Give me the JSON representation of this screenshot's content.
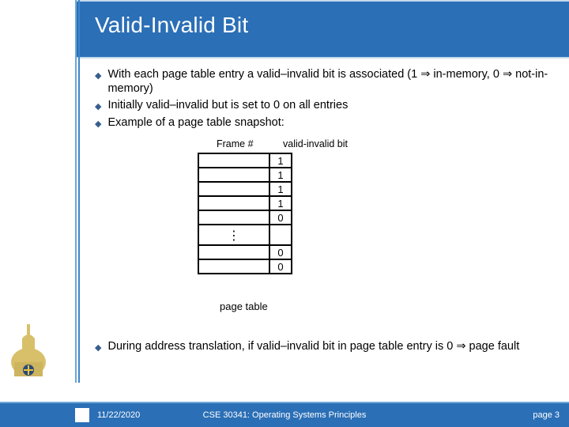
{
  "title": "Valid-Invalid Bit",
  "bullets_top": [
    "With each page table entry a valid–invalid bit is associated (1 ⇒ in-memory, 0 ⇒ not-in-memory)",
    "Initially valid–invalid but is set to 0 on all entries",
    "Example of a page table snapshot:"
  ],
  "bullets_bottom": [
    "During address translation, if valid–invalid bit in page table entry is 0 ⇒ page fault"
  ],
  "diagram": {
    "frame_label": "Frame #",
    "vib_label": "valid-invalid bit",
    "caption": "page table",
    "gap_glyph": "⋮",
    "rows": [
      {
        "frame": "",
        "vib": "1"
      },
      {
        "frame": "",
        "vib": "1"
      },
      {
        "frame": "",
        "vib": "1"
      },
      {
        "frame": "",
        "vib": "1"
      },
      {
        "frame": "",
        "vib": "0"
      },
      {
        "gap": true
      },
      {
        "frame": "",
        "vib": "0"
      },
      {
        "frame": "",
        "vib": "0"
      }
    ]
  },
  "footer": {
    "date": "11/22/2020",
    "course": "CSE 30341: Operating Systems Principles",
    "page": "page 3"
  },
  "colors": {
    "brand_blue": "#2b6fb6",
    "rule_light": "#6fa7d6"
  }
}
